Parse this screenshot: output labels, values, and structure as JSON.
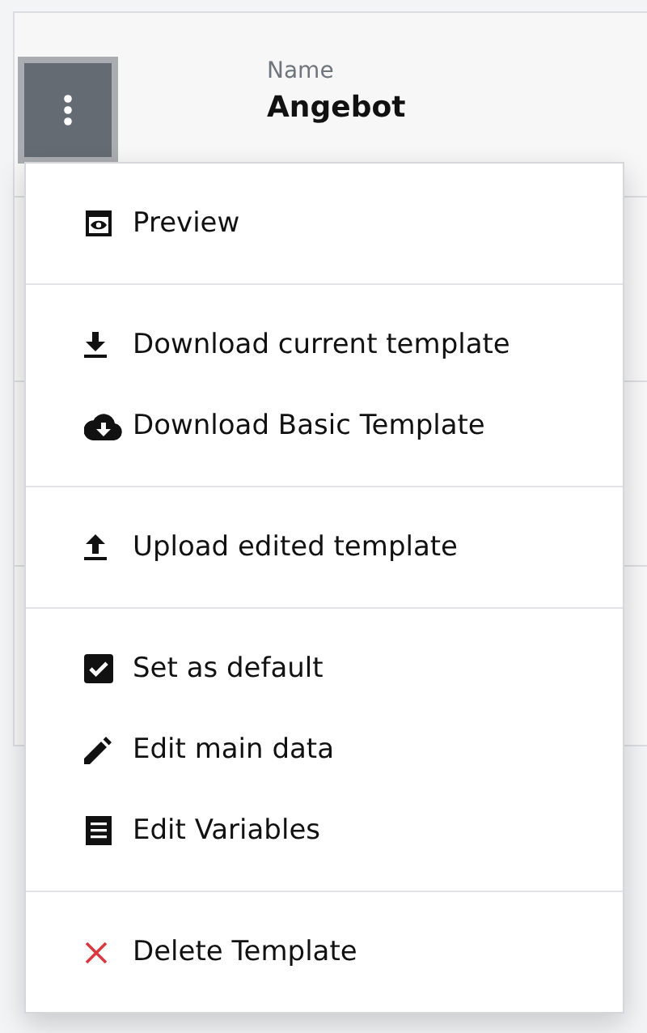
{
  "record": {
    "label": "Name",
    "value": "Angebot"
  },
  "menu": {
    "sections": [
      {
        "items": [
          {
            "kind": "preview",
            "label": "Preview"
          }
        ]
      },
      {
        "items": [
          {
            "kind": "download",
            "label": "Download current template"
          },
          {
            "kind": "cloud-download",
            "label": "Download Basic Template"
          }
        ]
      },
      {
        "items": [
          {
            "kind": "upload",
            "label": "Upload edited template"
          }
        ]
      },
      {
        "items": [
          {
            "kind": "check",
            "label": "Set as default"
          },
          {
            "kind": "edit",
            "label": "Edit main data"
          },
          {
            "kind": "list",
            "label": "Edit Variables"
          }
        ]
      },
      {
        "items": [
          {
            "kind": "delete",
            "label": "Delete Template"
          }
        ]
      }
    ]
  }
}
